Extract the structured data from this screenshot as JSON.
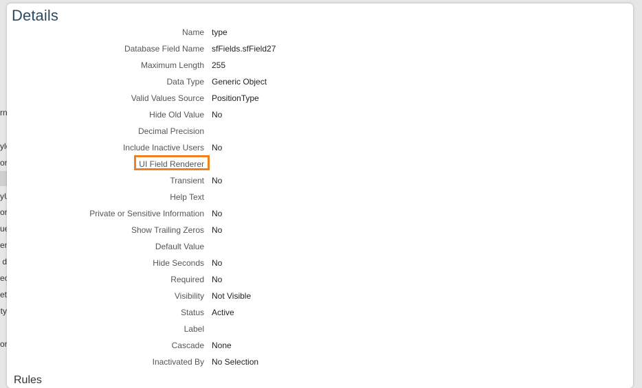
{
  "background": {
    "fragments": [
      "rna",
      "ylo",
      "orc",
      "yU",
      "or",
      "ue",
      "en",
      "d",
      "ec",
      "ete",
      "ty",
      "orc"
    ]
  },
  "panel": {
    "title": "Details",
    "highlight_color": "#f07f1e",
    "rows": [
      {
        "label": "Name",
        "value": "type"
      },
      {
        "label": "Database Field Name",
        "value": "sfFields.sfField27"
      },
      {
        "label": "Maximum Length",
        "value": "255"
      },
      {
        "label": "Data Type",
        "value": "Generic Object"
      },
      {
        "label": "Valid Values Source",
        "value": "PositionType"
      },
      {
        "label": "Hide Old Value",
        "value": "No"
      },
      {
        "label": "Decimal Precision",
        "value": ""
      },
      {
        "label": "Include Inactive Users",
        "value": "No"
      },
      {
        "label": "UI Field Renderer",
        "value": ""
      },
      {
        "label": "Transient",
        "value": "No"
      },
      {
        "label": "Help Text",
        "value": ""
      },
      {
        "label": "Private or Sensitive Information",
        "value": "No"
      },
      {
        "label": "Show Trailing Zeros",
        "value": "No"
      },
      {
        "label": "Default Value",
        "value": ""
      },
      {
        "label": "Hide Seconds",
        "value": "No"
      },
      {
        "label": "Required",
        "value": "No"
      },
      {
        "label": "Visibility",
        "value": "Not Visible"
      },
      {
        "label": "Status",
        "value": "Active"
      },
      {
        "label": "Label",
        "value": ""
      },
      {
        "label": "Cascade",
        "value": "None"
      },
      {
        "label": "Inactivated By",
        "value": "No Selection"
      }
    ],
    "next_section": "Rules"
  }
}
